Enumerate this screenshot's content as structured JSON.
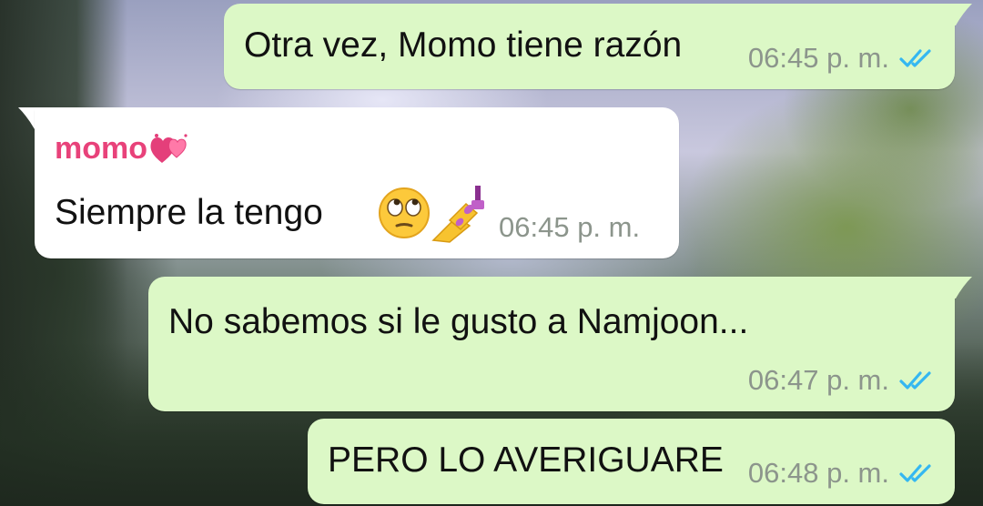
{
  "messages": [
    {
      "direction": "outgoing",
      "text": "Otra vez, Momo tiene razón",
      "time": "06:45 p. m.",
      "status_icon": "double-check-read-icon"
    },
    {
      "direction": "incoming",
      "sender": "momo",
      "sender_emoji": "two-hearts-emoji",
      "text": "Siempre la tengo",
      "emojis": [
        "face-with-rolling-eyes-emoji",
        "nail-polish-emoji"
      ],
      "time": "06:45 p. m."
    },
    {
      "direction": "outgoing",
      "text": "No sabemos si le gusto a Namjoon...",
      "time": "06:47 p. m.",
      "status_icon": "double-check-read-icon"
    },
    {
      "direction": "outgoing",
      "text": "PERO LO AVERIGUARE",
      "time": "06:48 p. m.",
      "status_icon": "double-check-read-icon"
    }
  ],
  "colors": {
    "outgoing_bubble": "#dcf8c6",
    "incoming_bubble": "#ffffff",
    "sender_name": "#e8427a",
    "read_ticks": "#34b7f1",
    "timestamp": "#8c958c"
  }
}
